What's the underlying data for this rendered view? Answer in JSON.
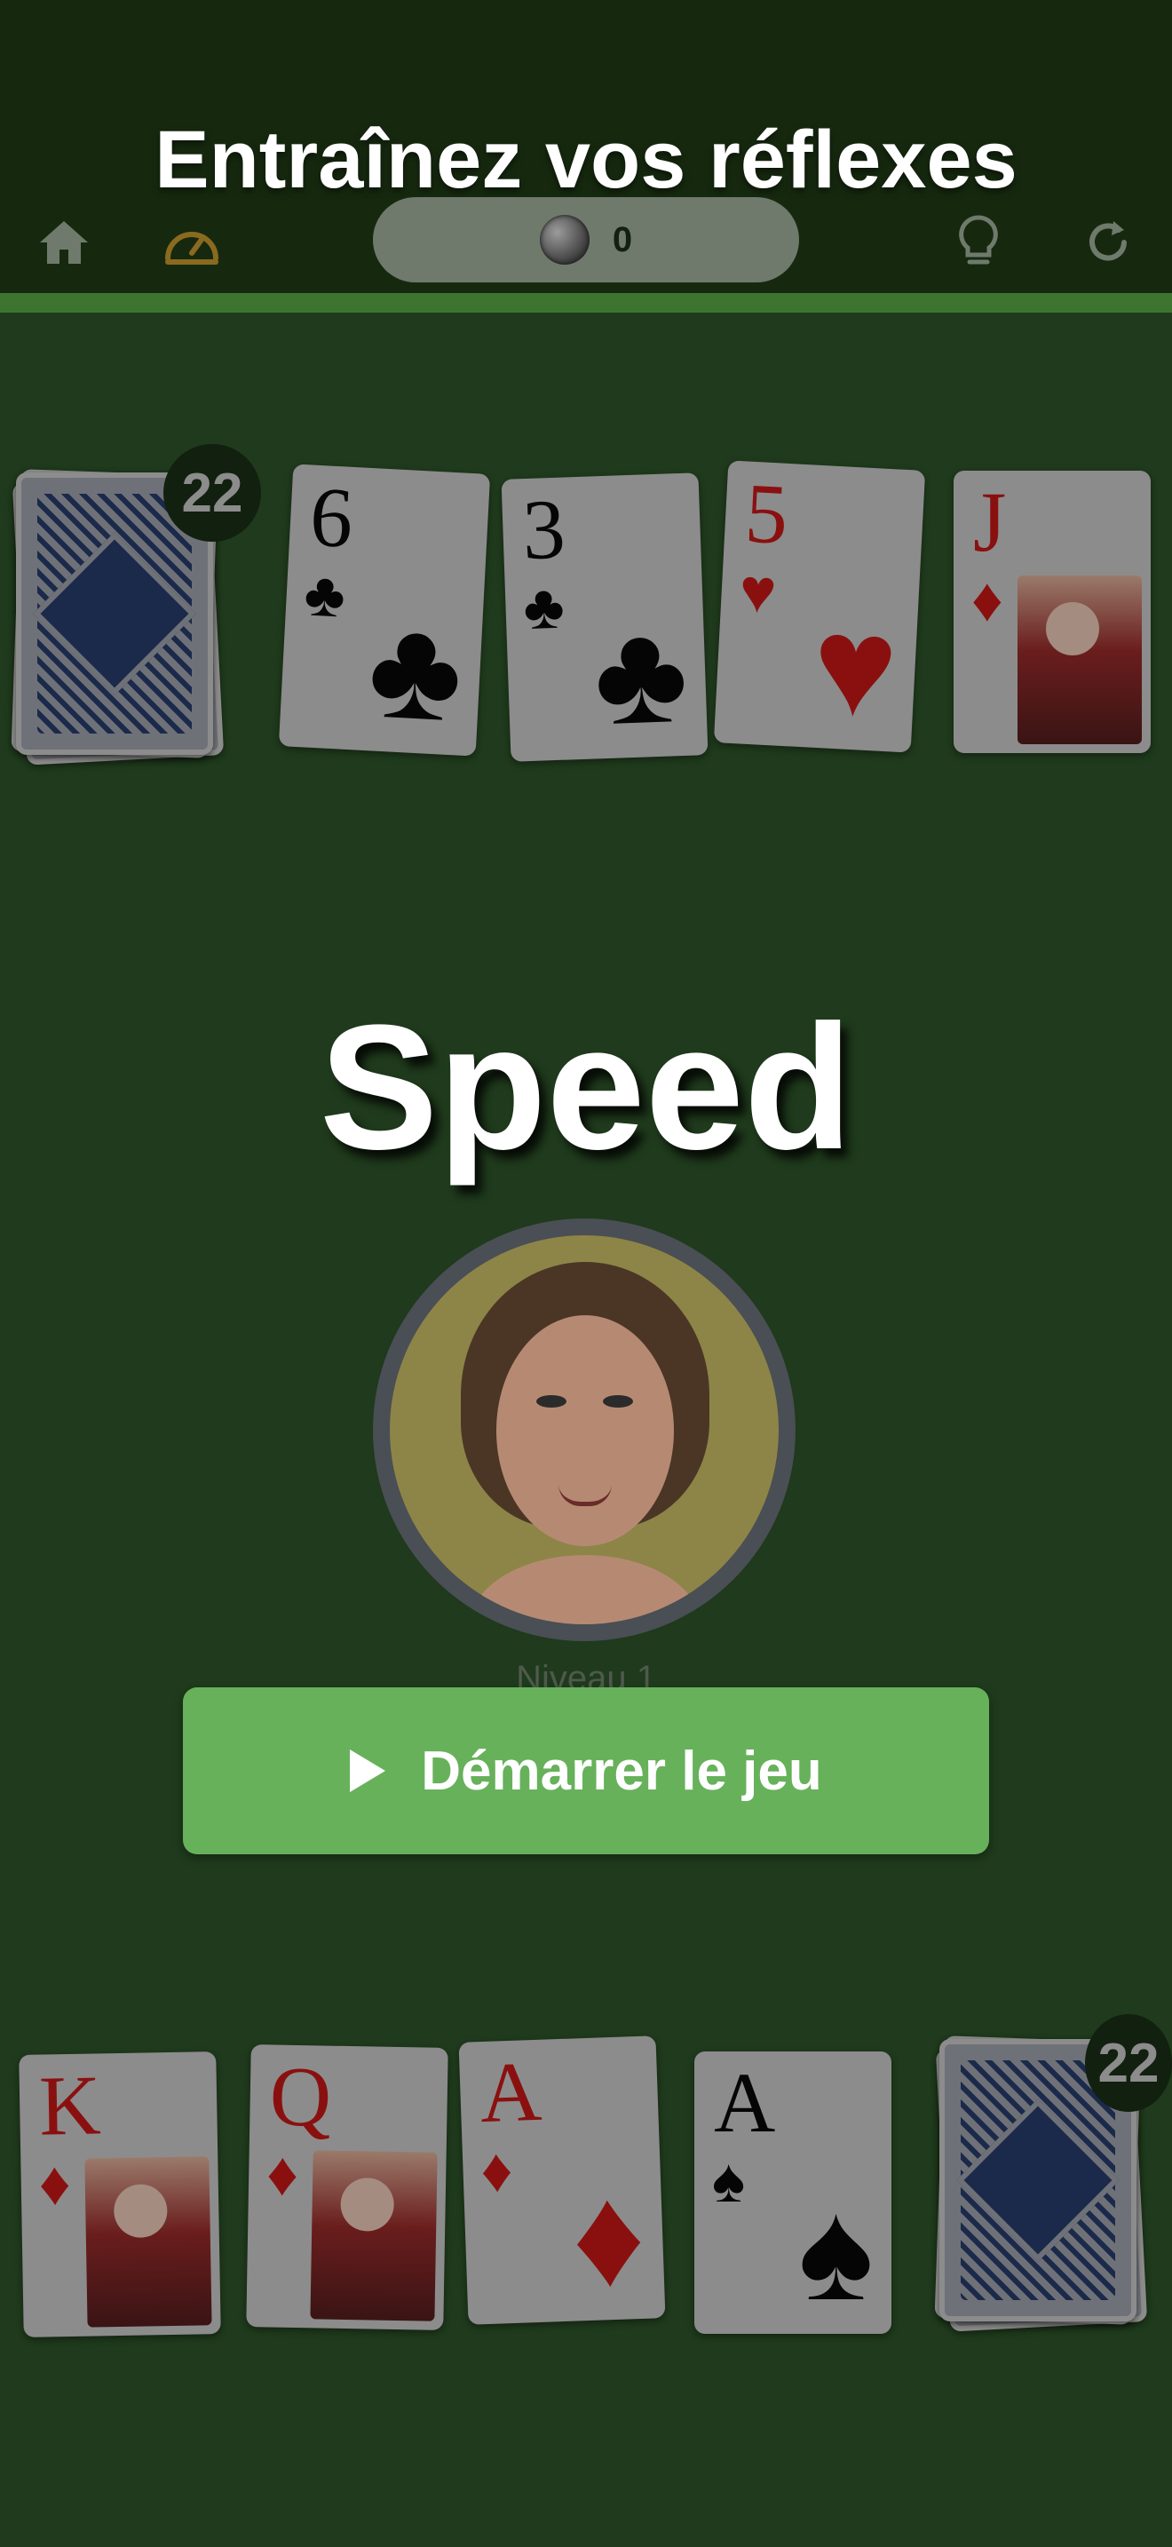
{
  "header": {
    "banner_title": "Entraînez vos réflexes",
    "score_value": "0",
    "icons": [
      "home-icon",
      "speedometer-icon",
      "coin-icon",
      "lightbulb-icon",
      "refresh-icon"
    ]
  },
  "opponent": {
    "deck_count": "22",
    "cards": [
      {
        "rank": "6",
        "suit": "♣",
        "color": "black"
      },
      {
        "rank": "3",
        "suit": "♣",
        "color": "black"
      },
      {
        "rank": "5",
        "suit": "♥",
        "color": "red"
      },
      {
        "rank": "J",
        "suit": "♦",
        "color": "red"
      }
    ]
  },
  "game": {
    "title": "Speed",
    "level_label": "Niveau 1",
    "start_button_label": "Démarrer le jeu"
  },
  "player": {
    "deck_count": "22",
    "cards": [
      {
        "rank": "K",
        "suit": "♦",
        "color": "red"
      },
      {
        "rank": "Q",
        "suit": "♦",
        "color": "red"
      },
      {
        "rank": "A",
        "suit": "♦",
        "color": "red"
      },
      {
        "rank": "A",
        "suit": "♠",
        "color": "black"
      }
    ]
  },
  "colors": {
    "background": "#1f3a1c",
    "accent_green": "#67b15b",
    "card_black": "#050505",
    "card_red": "#8a1010"
  }
}
